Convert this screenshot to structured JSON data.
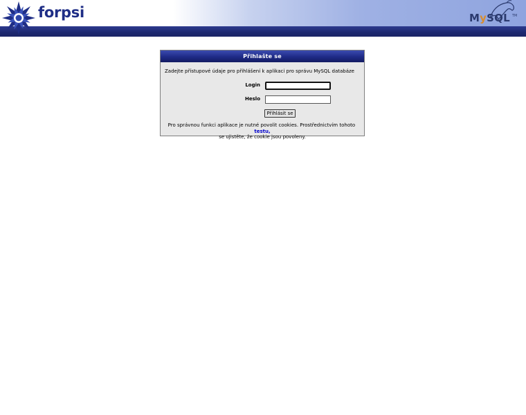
{
  "header": {
    "brand": "forpsi",
    "mysql_logo": {
      "my": "M",
      "y": "y",
      "sql": "SQL",
      "tm": "TM"
    },
    "colors": {
      "bar": "#1d2870",
      "brand_text": "#1f2e86",
      "gradient_end": "#8fa4df"
    }
  },
  "login": {
    "title": "Přihlašte se",
    "intro": "Zadejte přístupové údaje pro přihlášení k aplikaci pro správu MySQL databáze",
    "login_label": "Login",
    "login_value": "",
    "password_label": "Heslo",
    "password_value": "",
    "submit_label": "Přihlásit se",
    "note_before": "Pro správnou funkci aplikace je nutné povolit cookies. Prostřednictvím tohoto",
    "note_link": "testu",
    "note_comma": ",",
    "note_after": "se ujistěte, že cookie jsou povoleny.",
    "colors": {
      "title_bg": "#1e2a86",
      "box_bg": "#e8e8e8",
      "link": "#0000cc"
    }
  },
  "icons": {
    "forpsi_logo": "star-burst-icon",
    "mysql_dolphin": "dolphin-icon"
  }
}
